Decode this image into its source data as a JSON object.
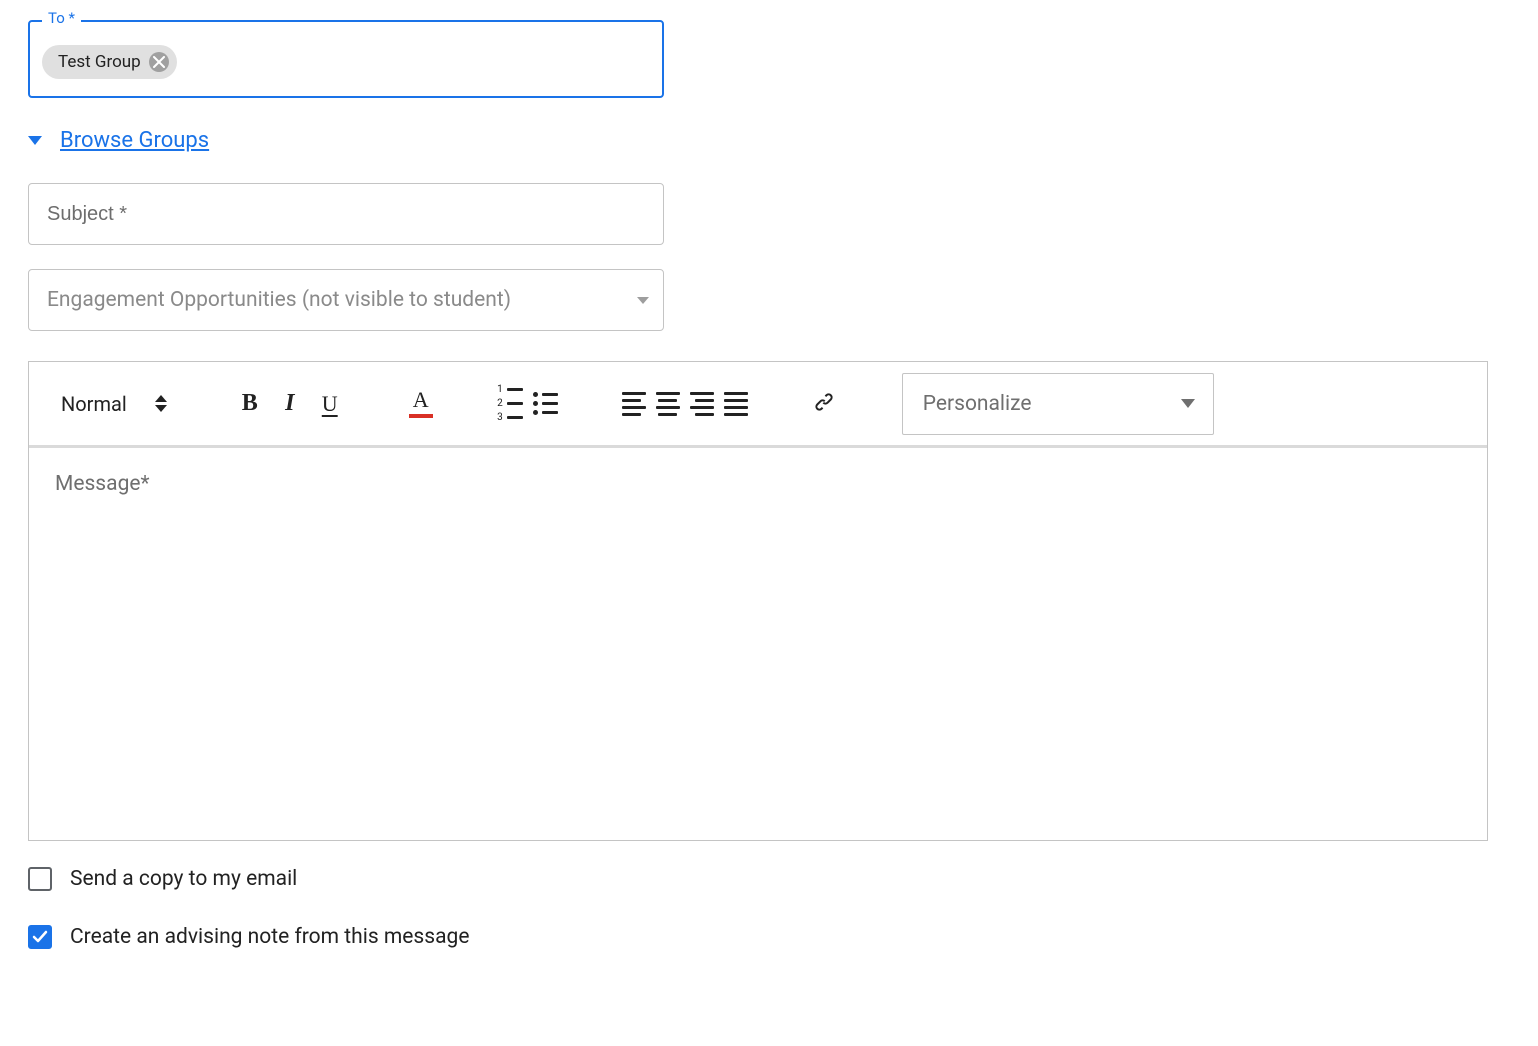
{
  "to": {
    "label": "To *",
    "chips": [
      {
        "label": "Test Group"
      }
    ]
  },
  "browse_groups": {
    "label": "Browse Groups"
  },
  "subject": {
    "placeholder": "Subject *",
    "value": ""
  },
  "engagement_select": {
    "placeholder": "Engagement Opportunities (not visible to student)"
  },
  "editor": {
    "heading_label": "Normal",
    "personalize_placeholder": "Personalize",
    "message_placeholder": "Message*",
    "message_value": ""
  },
  "checkboxes": {
    "send_copy": {
      "label": "Send a copy to my email",
      "checked": false
    },
    "advising_note": {
      "label": "Create an advising note from this message",
      "checked": true
    }
  }
}
